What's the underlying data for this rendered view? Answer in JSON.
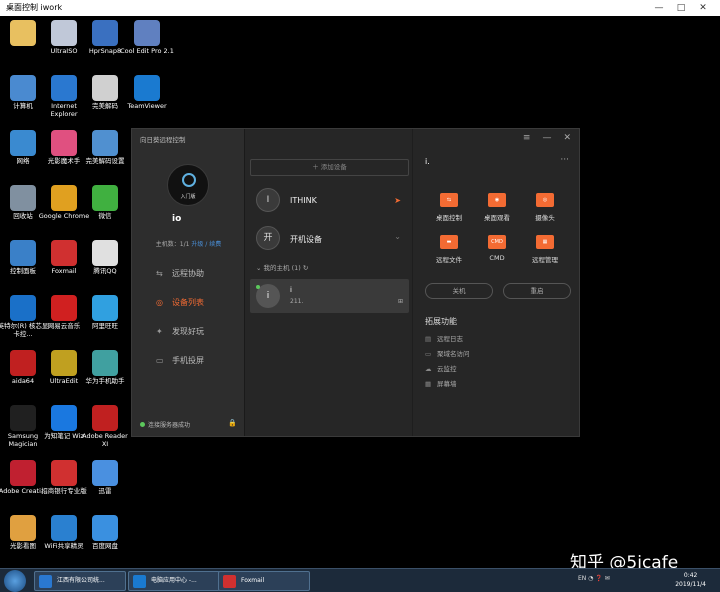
{
  "window": {
    "title": "桌面控制 iwork",
    "controls": [
      "—",
      "□",
      "✕"
    ],
    "collapse": "ˇ"
  },
  "desktop": {
    "icons": [
      {
        "label": "",
        "color": "#e8c060"
      },
      {
        "label": "UltraISO",
        "color": "#c0c8d8"
      },
      {
        "label": "HprSnap8",
        "color": "#3a70c0"
      },
      {
        "label": "Cool Edit Pro 2.1",
        "color": "#6080c0"
      },
      {
        "label": "计算机",
        "color": "#4a8ad0"
      },
      {
        "label": "Internet Explorer",
        "color": "#2a78d0"
      },
      {
        "label": "完美解码",
        "color": "#d0d0d0"
      },
      {
        "label": "TeamViewer",
        "color": "#1a7ad0"
      },
      {
        "label": "网络",
        "color": "#3a8ad0"
      },
      {
        "label": "光影魔术手",
        "color": "#e05080"
      },
      {
        "label": "完美解码设置",
        "color": "#5090d0"
      },
      {
        "label": "回收站",
        "color": "#8090a0"
      },
      {
        "label": "Google Chrome",
        "color": "#e0a020"
      },
      {
        "label": "微信",
        "color": "#40b040"
      },
      {
        "label": "控制面板",
        "color": "#3a80c8"
      },
      {
        "label": "Foxmail",
        "color": "#d03030"
      },
      {
        "label": "腾讯QQ",
        "color": "#e0e0e0"
      },
      {
        "label": "英特尔(R) 核芯显卡控...",
        "color": "#1a70c8"
      },
      {
        "label": "网易云音乐",
        "color": "#d02020"
      },
      {
        "label": "阿里旺旺",
        "color": "#30a0e0"
      },
      {
        "label": "aida64",
        "color": "#c02020"
      },
      {
        "label": "UltraEdit",
        "color": "#c0a020"
      },
      {
        "label": "华为手机助手",
        "color": "#40a0a0"
      },
      {
        "label": "Samsung Magician",
        "color": "#202020"
      },
      {
        "label": "为知笔记 Wiz",
        "color": "#1a78e0"
      },
      {
        "label": "Adobe Reader XI",
        "color": "#c02020"
      },
      {
        "label": "Adobe Creati...",
        "color": "#c02030"
      },
      {
        "label": "招商银行专业版",
        "color": "#d03030"
      },
      {
        "label": "迅雷",
        "color": "#4a90e0"
      },
      {
        "label": "光影看图",
        "color": "#e0a040"
      },
      {
        "label": "WiFi共享精灵",
        "color": "#2a80d0"
      },
      {
        "label": "百度网盘",
        "color": "#3a90e0"
      }
    ]
  },
  "app": {
    "title": "向日葵远程控制",
    "avatar_label": "入门版",
    "username": "io",
    "host_count": "主机数：1/1",
    "upgrade": "升级",
    "sep": "/",
    "renew": "续费",
    "nav": [
      {
        "label": "远程协助",
        "icon": "⇆"
      },
      {
        "label": "设备列表",
        "icon": "◎"
      },
      {
        "label": "发现好玩",
        "icon": "✦"
      },
      {
        "label": "手机投屏",
        "icon": "▭"
      }
    ],
    "status": "连接服务器成功",
    "lock": "🔒",
    "win_controls": [
      "≡",
      "—",
      "✕"
    ],
    "add_device": "＋ 添加设备",
    "devices": [
      {
        "initial": "I",
        "name": "ITHINK",
        "action": "➤"
      },
      {
        "initial": "开",
        "name": "开机设备",
        "action": "⌄"
      }
    ],
    "group": "⌄ 我的主机 (1) ↻",
    "host": {
      "initial": "i",
      "name": "i",
      "ip": "211.",
      "os": "⊞"
    },
    "right_name": "i.",
    "more": "···",
    "functions": [
      {
        "label": "桌面控制",
        "glyph": "⇆"
      },
      {
        "label": "桌面观看",
        "glyph": "◉"
      },
      {
        "label": "摄像头",
        "glyph": "◎"
      },
      {
        "label": "远程文件",
        "glyph": "▬"
      },
      {
        "label": "CMD",
        "glyph": "CMD"
      },
      {
        "label": "远程管理",
        "glyph": "▦"
      }
    ],
    "buttons": [
      "关机",
      "重启"
    ],
    "ext_title": "拓展功能",
    "ext": [
      {
        "label": "远程日志",
        "icon": "▤"
      },
      {
        "label": "聚域名访问",
        "icon": "▭"
      },
      {
        "label": "云监控",
        "icon": "☁"
      },
      {
        "label": "屏幕墙",
        "icon": "▦"
      }
    ]
  },
  "taskbar": {
    "tasks": [
      {
        "label": "江西有限公司统...",
        "color": "#2a78d0"
      },
      {
        "label": "电脑应用中心 -...",
        "color": "#1a7ad0"
      },
      {
        "label": "Foxmail",
        "color": "#d03030"
      }
    ],
    "tray": "EN ◔ ❓ ✉",
    "time": "0:42",
    "date": "2019/11/4"
  },
  "watermark": "知乎 @5icafe"
}
